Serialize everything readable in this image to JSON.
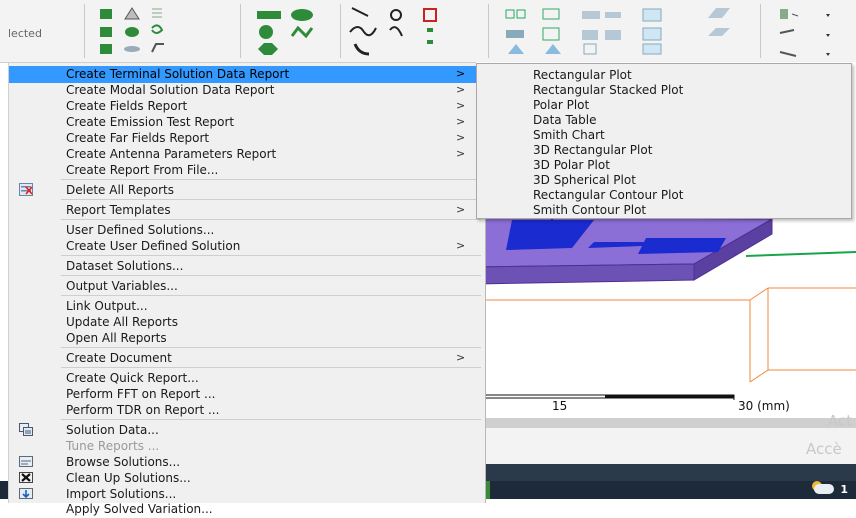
{
  "toolbar": {
    "selection_label": "lected"
  },
  "menu": {
    "items": [
      {
        "label": "Create Terminal Solution Data Report",
        "submenu": true
      },
      {
        "label": "Create Modal Solution Data Report",
        "submenu": true
      },
      {
        "label": "Create Fields Report",
        "submenu": true
      },
      {
        "label": "Create Emission Test Report",
        "submenu": true
      },
      {
        "label": "Create Far Fields Report",
        "submenu": true
      },
      {
        "label": "Create Antenna Parameters Report",
        "submenu": true
      },
      {
        "label": "Create Report From File...",
        "submenu": false
      },
      {
        "label": "Delete All Reports",
        "submenu": false
      },
      {
        "label": "Report Templates",
        "submenu": true
      },
      {
        "label": "User Defined Solutions...",
        "submenu": false
      },
      {
        "label": "Create User Defined Solution",
        "submenu": true
      },
      {
        "label": "Dataset Solutions...",
        "submenu": false
      },
      {
        "label": "Output Variables...",
        "submenu": false
      },
      {
        "label": "Link Output...",
        "submenu": false
      },
      {
        "label": "Update All Reports",
        "submenu": false
      },
      {
        "label": "Open All Reports",
        "submenu": false
      },
      {
        "label": "Create Document",
        "submenu": true
      },
      {
        "label": "Create Quick Report...",
        "submenu": false
      },
      {
        "label": "Perform FFT on Report ...",
        "submenu": false
      },
      {
        "label": "Perform TDR on Report ...",
        "submenu": false
      },
      {
        "label": "Solution Data...",
        "submenu": false
      },
      {
        "label": "Tune Reports ...",
        "submenu": false,
        "disabled": true
      },
      {
        "label": "Browse Solutions...",
        "submenu": false
      },
      {
        "label": "Clean Up Solutions...",
        "submenu": false
      },
      {
        "label": "Import Solutions...",
        "submenu": false
      },
      {
        "label": "Apply Solved Variation...",
        "submenu": false
      }
    ],
    "arrow_glyph": ">"
  },
  "submenu": {
    "items": [
      "Rectangular Plot",
      "Rectangular Stacked Plot",
      "Polar Plot",
      "Data Table",
      "Smith Chart",
      "3D Rectangular Plot",
      "3D Polar Plot",
      "3D Spherical Plot",
      "Rectangular Contour Plot",
      "Smith Contour Plot"
    ]
  },
  "viewport": {
    "scale_left": "15",
    "scale_right": "30 (mm)",
    "watermark_1": "Act",
    "watermark_2": "Accè"
  },
  "taskbar": {
    "clock": "1"
  },
  "colors": {
    "highlight": "#3399ff",
    "menu_bg": "#f0f0f0",
    "model_purple": "#8b6fd6",
    "model_blue": "#1a2bd0",
    "box_orange": "#f08a3c"
  },
  "icons": {
    "delete_reports": "delete-reports-icon",
    "solution_data": "solution-data-icon",
    "browse": "browse-solutions-icon",
    "clean_up": "clean-up-icon",
    "import": "import-icon"
  }
}
